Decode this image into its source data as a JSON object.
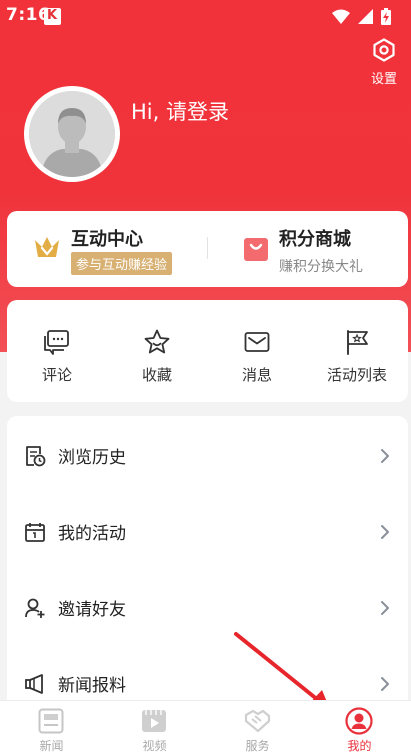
{
  "status_bar": {
    "time": "7:16"
  },
  "header": {
    "settings_label": "设置",
    "greeting": "Hi, 请登录"
  },
  "interact_card": {
    "left": {
      "title": "互动中心",
      "badge": "参与互动赚经验"
    },
    "right": {
      "title": "积分商城",
      "subtitle": "赚积分换大礼"
    }
  },
  "quick_actions": [
    {
      "label": "评论",
      "icon": "comment-icon"
    },
    {
      "label": "收藏",
      "icon": "star-icon"
    },
    {
      "label": "消息",
      "icon": "mail-icon"
    },
    {
      "label": "活动列表",
      "icon": "flag-icon"
    }
  ],
  "menu": [
    {
      "label": "浏览历史",
      "icon": "history-icon"
    },
    {
      "label": "我的活动",
      "icon": "calendar-icon"
    },
    {
      "label": "邀请好友",
      "icon": "add-user-icon"
    },
    {
      "label": "新闻报料",
      "icon": "megaphone-icon"
    }
  ],
  "tabs": [
    {
      "label": "新闻",
      "icon": "news-icon",
      "active": false
    },
    {
      "label": "视频",
      "icon": "video-icon",
      "active": false
    },
    {
      "label": "服务",
      "icon": "handshake-icon",
      "active": false
    },
    {
      "label": "我的",
      "icon": "profile-icon",
      "active": true
    }
  ],
  "colors": {
    "brand_red": "#f0333b",
    "badge_gold": "#d7b072",
    "tab_inactive": "#a8a8a8",
    "tab_active": "#e8313b"
  }
}
